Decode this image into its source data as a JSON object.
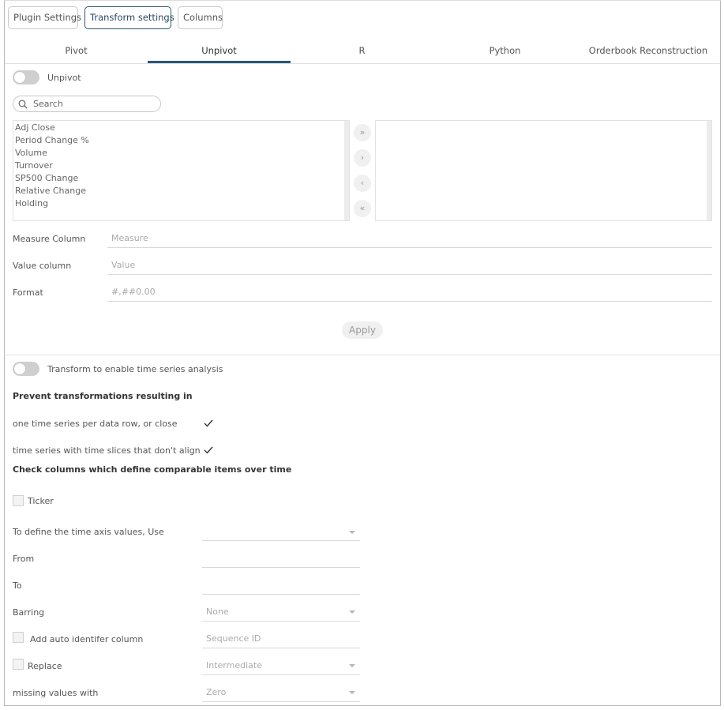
{
  "top_tabs": [
    "Plugin Settings",
    "Transform settings",
    "Columns"
  ],
  "sub_tabs": [
    "Pivot",
    "Unpivot",
    "R",
    "Python",
    "Orderbook Reconstruction"
  ],
  "unpivot": {
    "toggle_label": "Unpivot",
    "toggle_on": false,
    "search_placeholder": "Search",
    "available_columns": [
      "Adj Close",
      "Period Change %",
      "Volume",
      "Turnover",
      "SP500 Change",
      "Relative Change",
      "Holding"
    ],
    "selected_columns": [],
    "move_buttons": [
      "»",
      "›",
      "‹",
      "«"
    ],
    "measure_label": "Measure Column",
    "measure_value": "Measure",
    "value_label": "Value column",
    "value_value": "Value",
    "format_label": "Format",
    "format_value": "#,##0.00",
    "apply_label": "Apply"
  },
  "timeseries": {
    "toggle_label": "Transform to enable time series analysis",
    "toggle_on": false,
    "prevent_heading": "Prevent transformations resulting in",
    "opt1_label": "one time series per data row, or close",
    "opt1_checked": true,
    "opt2_label": "time series with time slices that don't align",
    "opt2_checked": true,
    "check_heading": "Check columns which define comparable items over time",
    "ticker_label": "Ticker",
    "ticker_checked": false,
    "axis_label": "To define the time axis values, Use",
    "axis_value": "",
    "from_label": "From",
    "from_value": "",
    "to_label": "To",
    "to_value": "",
    "barring_label": "Barring",
    "barring_value": "None",
    "auto_id_label": "Add auto identifer column",
    "auto_id_checked": false,
    "auto_id_value": "Sequence ID",
    "replace_label": "Replace",
    "replace_checked": false,
    "replace_value": "Intermediate",
    "missing_label": "missing values with",
    "missing_value": "Zero"
  },
  "colors": {
    "accent": "#24597a",
    "toggle_off": "#cfcfcf"
  }
}
